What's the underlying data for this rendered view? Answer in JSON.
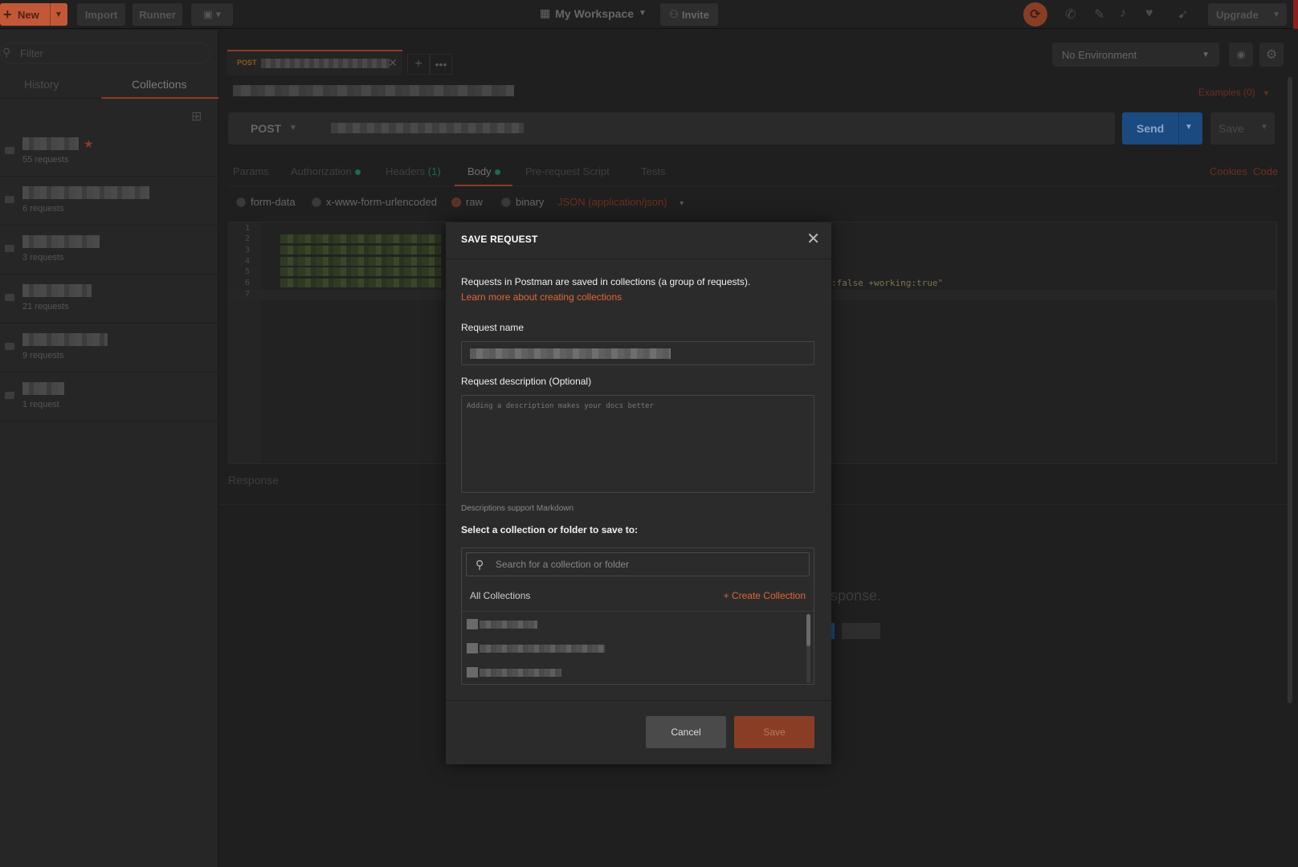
{
  "topbar": {
    "new_label": "New",
    "import_label": "Import",
    "runner_label": "Runner",
    "workspace_label": "My Workspace",
    "invite_label": "Invite",
    "upgrade_label": "Upgrade"
  },
  "sidebar": {
    "filter_placeholder": "Filter",
    "tab_history": "History",
    "tab_collections": "Collections",
    "collections": [
      {
        "count": "55 requests",
        "starred": true
      },
      {
        "count": "6 requests"
      },
      {
        "count": "3 requests"
      },
      {
        "count": "21 requests"
      },
      {
        "count": "9 requests"
      },
      {
        "count": "1 request"
      }
    ]
  },
  "tabs": {
    "active_method": "POST"
  },
  "environment": {
    "selected": "No Environment"
  },
  "request": {
    "examples_label": "Examples (0)",
    "method": "POST",
    "send_label": "Send",
    "save_label": "Save",
    "tabs": {
      "params": "Params",
      "authorization": "Authorization",
      "headers": "Headers",
      "headers_count": "(1)",
      "body": "Body",
      "prerequest": "Pre-request Script",
      "tests": "Tests"
    },
    "cookies_label": "Cookies",
    "code_label": "Code",
    "body_options": {
      "form_data": "form-data",
      "urlencoded": "x-www-form-urlencoded",
      "raw": "raw",
      "binary": "binary",
      "content_type": "JSON (application/json)"
    },
    "line_numbers": [
      "1",
      "2",
      "3",
      "4",
      "5",
      "6",
      "7"
    ],
    "code_visible_tail": ":false +working:true\""
  },
  "response": {
    "header": "Response",
    "hint_fragment": "sponse."
  },
  "modal": {
    "title": "SAVE REQUEST",
    "info": "Requests in Postman are saved in collections (a group of requests).",
    "learn_more": "Learn more about creating collections",
    "name_label": "Request name",
    "description_label": "Request description (Optional)",
    "description_placeholder": "Adding a description makes your docs better",
    "markdown_hint": "Descriptions support Markdown",
    "select_label": "Select a collection or folder to save to:",
    "search_placeholder": "Search for a collection or folder",
    "all_collections": "All Collections",
    "create_collection": "+ Create Collection",
    "cancel_label": "Cancel",
    "save_label": "Save"
  },
  "colors": {
    "accent": "#e0663a",
    "send_blue": "#1b4a80",
    "modal_bg": "#2b2b2b",
    "app_bg": "#1f1f1f"
  }
}
